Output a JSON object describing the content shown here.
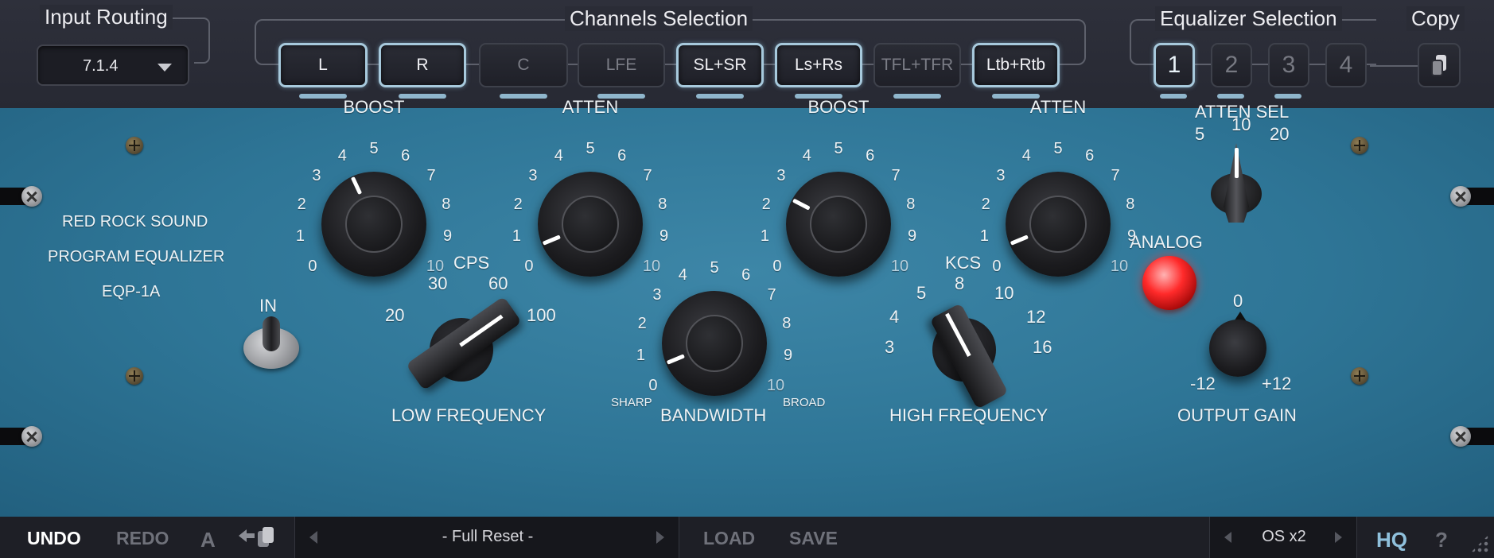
{
  "header": {
    "input_routing": {
      "title": "Input Routing",
      "value": "7.1.4"
    },
    "channels": {
      "title": "Channels Selection",
      "buttons": [
        {
          "label": "L",
          "active": true
        },
        {
          "label": "R",
          "active": true
        },
        {
          "label": "C",
          "active": false
        },
        {
          "label": "LFE",
          "active": false
        },
        {
          "label": "SL+SR",
          "active": true
        },
        {
          "label": "Ls+Rs",
          "active": true
        },
        {
          "label": "TFL+TFR",
          "active": false
        },
        {
          "label": "Ltb+Rtb",
          "active": true
        }
      ]
    },
    "equalizer": {
      "title": "Equalizer Selection",
      "buttons": [
        {
          "label": "1",
          "active": true
        },
        {
          "label": "2",
          "active": false
        },
        {
          "label": "3",
          "active": false
        },
        {
          "label": "4",
          "active": false
        }
      ]
    },
    "copy": {
      "title": "Copy"
    }
  },
  "panel": {
    "brand": [
      "RED ROCK SOUND",
      "PROGRAM EQUALIZER",
      "EQP-1A"
    ],
    "in_label": "IN",
    "knobs": [
      {
        "label": "BOOST",
        "value": 4,
        "scale": [
          "0",
          "1",
          "2",
          "3",
          "4",
          "5",
          "6",
          "7",
          "8",
          "9",
          "10"
        ]
      },
      {
        "label": "ATTEN",
        "value": 0.5,
        "scale": [
          "0",
          "1",
          "2",
          "3",
          "4",
          "5",
          "6",
          "7",
          "8",
          "9",
          "10"
        ]
      },
      {
        "label": "BOOST",
        "value": 2.5,
        "scale": [
          "0",
          "1",
          "2",
          "3",
          "4",
          "5",
          "6",
          "7",
          "8",
          "9",
          "10"
        ]
      },
      {
        "label": "ATTEN",
        "value": 0.5,
        "scale": [
          "0",
          "1",
          "2",
          "3",
          "4",
          "5",
          "6",
          "7",
          "8",
          "9",
          "10"
        ]
      }
    ],
    "atten_sel": {
      "label": "ATTEN SEL",
      "options": [
        "5",
        "10",
        "20"
      ],
      "selected": "10"
    },
    "analog": {
      "label": "ANALOG",
      "on": true
    },
    "low_freq": {
      "title": "CPS",
      "label": "LOW FREQUENCY",
      "options": [
        "20",
        "30",
        "60",
        "100"
      ],
      "selected": "100"
    },
    "bandwidth": {
      "label": "BANDWIDTH",
      "sharp": "SHARP",
      "broad": "BROAD",
      "value": 0.5,
      "scale": [
        "0",
        "1",
        "2",
        "3",
        "4",
        "5",
        "6",
        "7",
        "8",
        "9",
        "10"
      ]
    },
    "high_freq": {
      "title": "KCS",
      "label": "HIGH FREQUENCY",
      "options": [
        "3",
        "4",
        "5",
        "8",
        "10",
        "12",
        "16"
      ],
      "selected": "5"
    },
    "output_gain": {
      "label": "OUTPUT GAIN",
      "zero": "0",
      "min": "-12",
      "max": "+12",
      "value": 0
    }
  },
  "footer": {
    "undo": "UNDO",
    "redo": "REDO",
    "ab": "A",
    "preset": "- Full Reset -",
    "load": "LOAD",
    "save": "SAVE",
    "os": "OS x2",
    "hq": "HQ",
    "help": "?"
  },
  "colors": {
    "panel": "#2e7596",
    "active_outline": "#a7c9dc",
    "led": "#ff2a2a"
  }
}
